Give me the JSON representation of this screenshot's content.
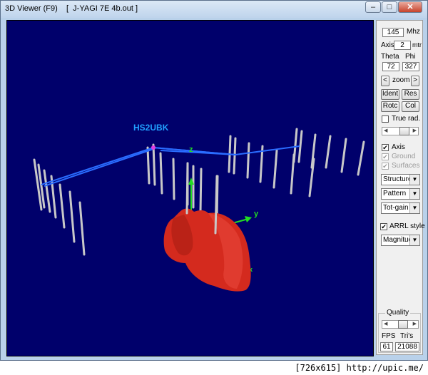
{
  "window": {
    "app_name": "3D Viewer (F9)",
    "file_title": "[  J-YAGI 7E 4b.out ]",
    "minimize_glyph": "–",
    "maximize_glyph": "□",
    "close_glyph": "✕"
  },
  "scene": {
    "callsign_label": "HS2UBK",
    "axis_z_label": "z",
    "axis_y_label": "y",
    "axis_x_label": "x",
    "background_color": "#00006b",
    "element_color": "#c8c8c8",
    "feed_color": "#2a6cff",
    "pattern_color": "#d42a1e",
    "label_color": "#21a0ff"
  },
  "panel": {
    "freq_value": "145",
    "freq_unit": "Mhz",
    "axis_label": "Axis",
    "axis_value": "2",
    "axis_unit": "mtr",
    "theta_label": "Theta",
    "phi_label": "Phi",
    "theta_value": "72",
    "phi_value": "327",
    "zoom_left": "<",
    "zoom_label": "zoom",
    "zoom_right": ">",
    "ident_label": "Ident",
    "res_label": "Res",
    "rotc_label": "Rotc",
    "col_label": "Col",
    "true_rad_label": "True rad.",
    "axis_check_label": "Axis",
    "ground_label": "Ground",
    "surfaces_label": "Surfaces",
    "structure_label": "Structure",
    "pattern_label": "Pattern",
    "totgain_label": "Tot-gain",
    "arrl_label": "ARRL style",
    "magnitude_label": "Magnitud",
    "quality_label": "Quality",
    "fps_label": "FPS",
    "tris_label": "Tri's",
    "fps_value": "61",
    "tris_value": "21088",
    "check_mark": "✔",
    "dropdown_arrow": "▼"
  },
  "footer": {
    "text": "[726x615] http://upic.me/"
  }
}
